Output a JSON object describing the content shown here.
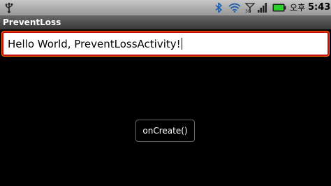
{
  "status_bar": {
    "ampm": "오후",
    "time": "5:43",
    "icons": [
      "usb-icon",
      "bluetooth-icon",
      "wifi-icon",
      "signal-icon",
      "cell-bars-icon",
      "battery-icon"
    ],
    "battery_color": "#2bd02b"
  },
  "title_bar": {
    "title": "PreventLoss"
  },
  "main": {
    "edit_text_value": "Hello World, PreventLossActivity!",
    "button_label": "onCreate()"
  },
  "colors": {
    "background": "#000000",
    "edit_border": "#c81010",
    "edit_focus": "#ff6a00"
  }
}
